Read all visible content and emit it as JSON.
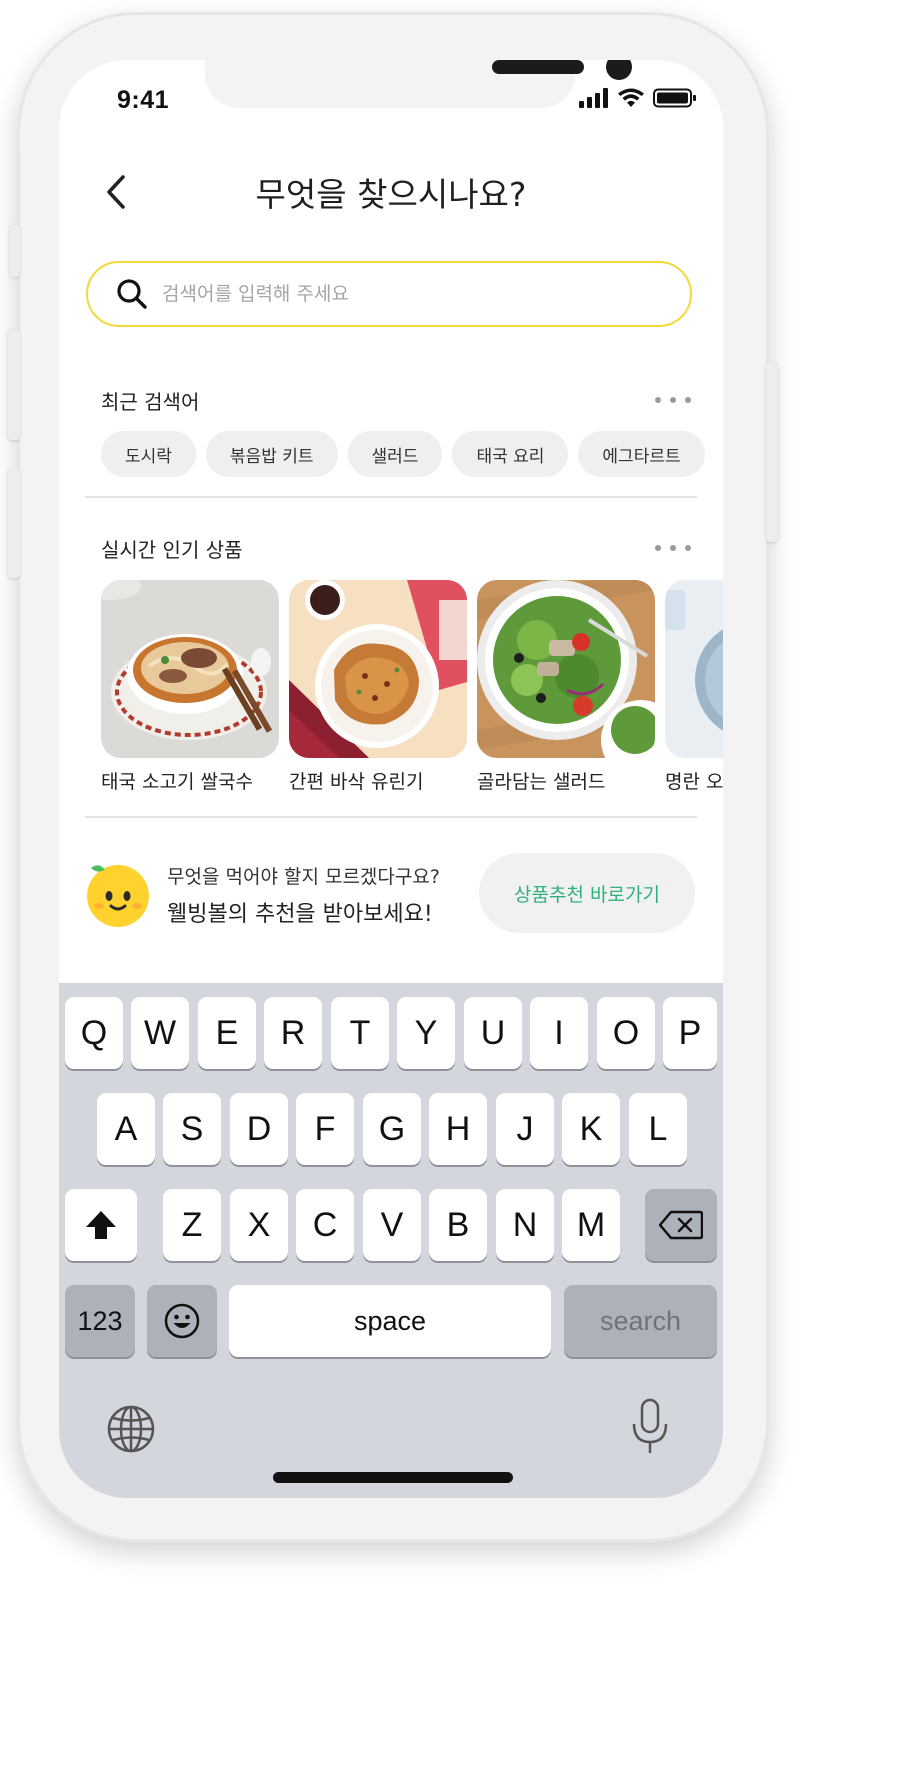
{
  "status": {
    "time": "9:41"
  },
  "header": {
    "title": "무엇을 찾으시나요?"
  },
  "search": {
    "placeholder": "검색어를 입력해 주세요"
  },
  "recent": {
    "title": "최근 검색어",
    "items": [
      "도시락",
      "볶음밥 키트",
      "샐러드",
      "태국 요리",
      "에그타르트"
    ]
  },
  "popular": {
    "title": "실시간 인기 상품",
    "items": [
      {
        "name": "태국 소고기 쌀국수"
      },
      {
        "name": "간편 바삭 유린기"
      },
      {
        "name": "골라담는 샐러드"
      },
      {
        "name": "명란 오"
      }
    ]
  },
  "recommend": {
    "line1": "무엇을 먹어야 할지 모르겠다구요?",
    "line2": "웰빙볼의 추천을 받아보세요!",
    "button": "상품추천 바로가기",
    "accent": "#2fb27a"
  },
  "keyboard": {
    "row1": [
      "Q",
      "W",
      "E",
      "R",
      "T",
      "Y",
      "U",
      "I",
      "O",
      "P"
    ],
    "row2": [
      "A",
      "S",
      "D",
      "F",
      "G",
      "H",
      "J",
      "K",
      "L"
    ],
    "row3": [
      "Z",
      "X",
      "C",
      "V",
      "B",
      "N",
      "M"
    ],
    "numbers_label": "123",
    "space_label": "space",
    "search_label": "search"
  },
  "colors": {
    "search_border": "#f3d93a",
    "keyboard_bg": "#d3d6dc"
  }
}
